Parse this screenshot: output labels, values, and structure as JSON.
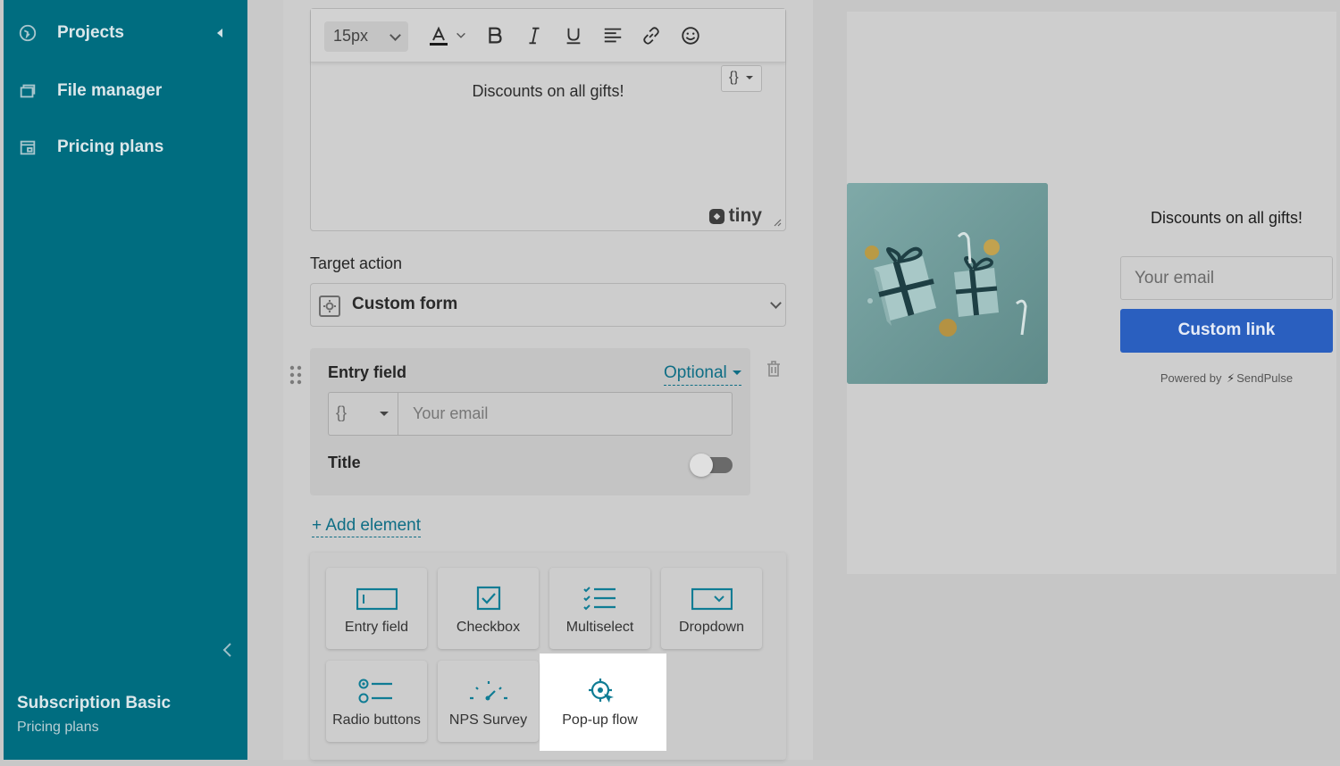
{
  "sidebar": {
    "items": [
      {
        "label": "Projects",
        "icon": "projects-icon"
      },
      {
        "label": "File manager",
        "icon": "file-manager-icon"
      },
      {
        "label": "Pricing plans",
        "icon": "pricing-plans-icon"
      }
    ],
    "subscription_title": "Subscription Basic",
    "subscription_link": "Pricing plans"
  },
  "editor": {
    "font_size": "15px",
    "content_text": "Discounts on all gifts!",
    "tiny_logo": "tiny",
    "variable_button": "{}"
  },
  "target_action": {
    "label": "Target action",
    "value": "Custom form"
  },
  "entry_field": {
    "title": "Entry field",
    "optional_label": "Optional",
    "variable_symbol": "{}",
    "placeholder": "Your email",
    "title_toggle_label": "Title",
    "title_toggle_on": false
  },
  "add_element_label": "+ Add element",
  "palette": {
    "tiles": [
      {
        "label": "Entry field",
        "icon": "entry-field-icon"
      },
      {
        "label": "Checkbox",
        "icon": "checkbox-icon"
      },
      {
        "label": "Multiselect",
        "icon": "multiselect-icon"
      },
      {
        "label": "Dropdown",
        "icon": "dropdown-icon"
      },
      {
        "label": "Radio buttons",
        "icon": "radio-buttons-icon"
      },
      {
        "label": "NPS Survey",
        "icon": "nps-survey-icon"
      },
      {
        "label": "Pop-up flow",
        "icon": "popup-flow-icon"
      }
    ]
  },
  "preview": {
    "heading": "Discounts on all gifts!",
    "email_placeholder": "Your email",
    "button_label": "Custom link",
    "powered_prefix": "Powered by",
    "powered_brand": "SendPulse"
  },
  "colors": {
    "sidebar": "#006d80",
    "link": "#0f6e85",
    "preview_button": "#2a5fbf",
    "accent_icon": "#0f7c94"
  }
}
